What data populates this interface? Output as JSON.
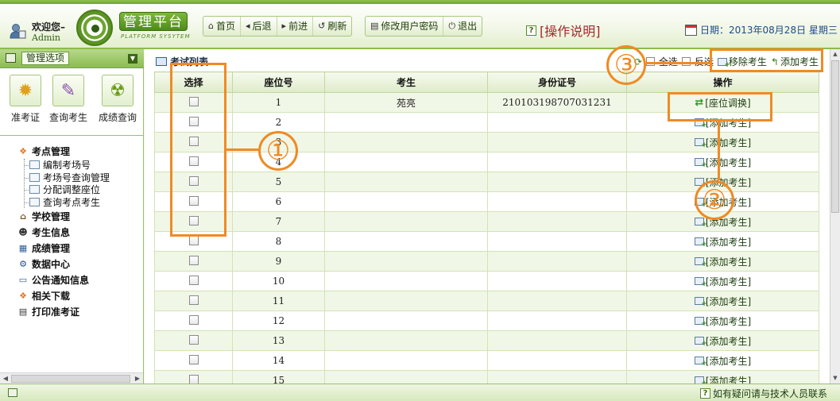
{
  "header": {
    "welcome": "欢迎您–",
    "username": "Admin",
    "brand": "管理平台",
    "brand_sub": "PLATFORM SYSYTEM",
    "nav": [
      {
        "label": "首页",
        "icon": "home-icon"
      },
      {
        "label": "后退",
        "icon": "back-arrow-icon"
      },
      {
        "label": "前进",
        "icon": "forward-arrow-icon"
      },
      {
        "label": "刷新",
        "icon": "refresh-icon"
      }
    ],
    "nav2": [
      {
        "label": "修改用户密码",
        "icon": "password-icon"
      },
      {
        "label": "退出",
        "icon": "power-icon"
      }
    ],
    "help": "[操作说明]",
    "date": "日期：2013年08月28日 星期三"
  },
  "sidebar": {
    "title": "管理选项",
    "quick": [
      {
        "label": "准考证",
        "icon": "gears-icon"
      },
      {
        "label": "查询考生",
        "icon": "search-docs-icon"
      },
      {
        "label": "成绩查询",
        "icon": "radiation-icon"
      }
    ],
    "tree": [
      {
        "label": "考点管理",
        "icon": "group-icon",
        "children": [
          "编制考场号",
          "考场号查询管理",
          "分配调整座位",
          "查询考点考生"
        ]
      },
      {
        "label": "学校管理",
        "icon": "school-icon"
      },
      {
        "label": "考生信息",
        "icon": "student-icon"
      },
      {
        "label": "成绩管理",
        "icon": "grades-icon"
      },
      {
        "label": "数据中心",
        "icon": "database-icon"
      },
      {
        "label": "公告通知信息",
        "icon": "book-icon"
      },
      {
        "label": "相关下载",
        "icon": "download-icon"
      },
      {
        "label": "打印准考证",
        "icon": "print-icon"
      }
    ]
  },
  "panel": {
    "title": "考试列表",
    "select_all": "全选",
    "invert": "反选",
    "remove": "移除考生",
    "add": "添加考生"
  },
  "table": {
    "headers": [
      "选择",
      "座位号",
      "考生",
      "身份证号",
      "操作"
    ],
    "rows": [
      {
        "seat": "1",
        "name": "苑亮",
        "id": "210103198707031231",
        "action": "[座位调换]"
      },
      {
        "seat": "2",
        "name": "",
        "id": "",
        "action": "[添加考生]"
      },
      {
        "seat": "3",
        "name": "",
        "id": "",
        "action": "[添加考生]"
      },
      {
        "seat": "4",
        "name": "",
        "id": "",
        "action": "[添加考生]"
      },
      {
        "seat": "5",
        "name": "",
        "id": "",
        "action": "[添加考生]"
      },
      {
        "seat": "6",
        "name": "",
        "id": "",
        "action": "[添加考生]"
      },
      {
        "seat": "7",
        "name": "",
        "id": "",
        "action": "[添加考生]"
      },
      {
        "seat": "8",
        "name": "",
        "id": "",
        "action": "[添加考生]"
      },
      {
        "seat": "9",
        "name": "",
        "id": "",
        "action": "[添加考生]"
      },
      {
        "seat": "10",
        "name": "",
        "id": "",
        "action": "[添加考生]"
      },
      {
        "seat": "11",
        "name": "",
        "id": "",
        "action": "[添加考生]"
      },
      {
        "seat": "12",
        "name": "",
        "id": "",
        "action": "[添加考生]"
      },
      {
        "seat": "13",
        "name": "",
        "id": "",
        "action": "[添加考生]"
      },
      {
        "seat": "14",
        "name": "",
        "id": "",
        "action": "[添加考生]"
      },
      {
        "seat": "15",
        "name": "",
        "id": "",
        "action": "[添加考生]"
      }
    ]
  },
  "footer": {
    "contact": "如有疑问请与技术人员联系"
  },
  "annotations": {
    "one": "①",
    "two": "②",
    "three": "③"
  },
  "colors": {
    "accent": "#8dbb4b",
    "annotation": "#f08a24",
    "help_text": "#a4292b",
    "date_text": "#1d4a86"
  }
}
